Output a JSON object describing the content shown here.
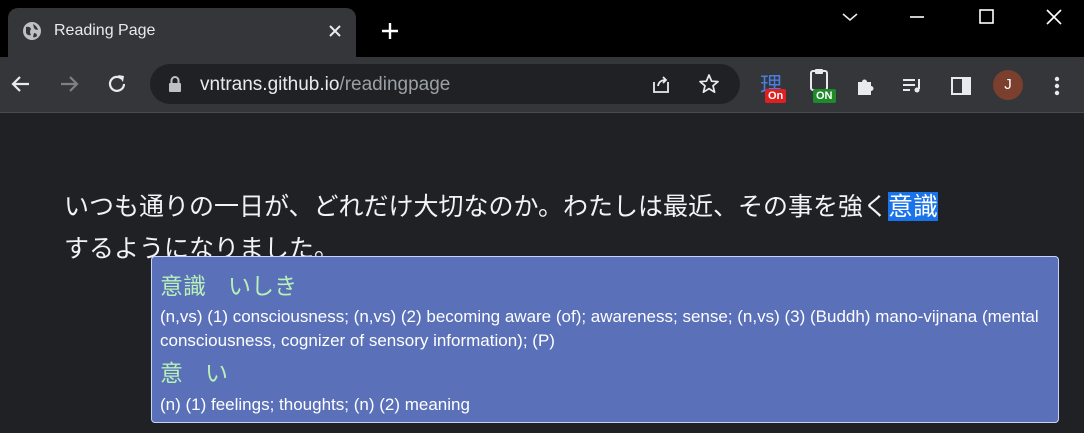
{
  "tab": {
    "title": "Reading Page"
  },
  "omnibox": {
    "host": "vntrans.github.io",
    "path": "/readingpage"
  },
  "extensions": {
    "badge1": "On",
    "badge1_glyph": "理",
    "badge2": "ON"
  },
  "profile": {
    "initial": "J"
  },
  "page": {
    "text_before": "いつも通りの一日が、どれだけ大切なのか。わたしは最近、その事を強く",
    "highlight": "意識",
    "text_after": "するようになりました。"
  },
  "popup": {
    "entries": [
      {
        "word": "意識",
        "reading": "いしき",
        "definition": "(n,vs) (1) consciousness; (n,vs) (2) becoming aware (of); awareness; sense; (n,vs) (3) (Buddh) mano-vijnana (mental consciousness, cognizer of sensory information); (P)"
      },
      {
        "word": "意",
        "reading": "い",
        "definition": "(n) (1) feelings; thoughts; (n) (2) meaning"
      }
    ]
  },
  "colors": {
    "highlight": "#1a73e8",
    "popup_bg": "#5a70b8",
    "popup_heading": "#b8f0b8"
  }
}
